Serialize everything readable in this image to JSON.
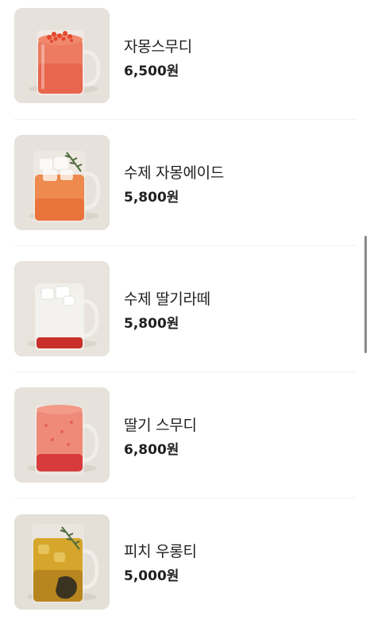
{
  "menu": {
    "items": [
      {
        "name": "자몽스무디",
        "price": "6,500원"
      },
      {
        "name": "수제 자몽에이드",
        "price": "5,800원"
      },
      {
        "name": "수제 딸기라떼",
        "price": "5,800원"
      },
      {
        "name": "딸기 스무디",
        "price": "6,800원"
      },
      {
        "name": "피치 우롱티",
        "price": "5,000원"
      }
    ]
  },
  "images": [
    {
      "icon": "grapefruit-smoothie-image"
    },
    {
      "icon": "grapefruit-ade-image"
    },
    {
      "icon": "strawberry-latte-image"
    },
    {
      "icon": "strawberry-smoothie-image"
    },
    {
      "icon": "peach-oolong-tea-image"
    }
  ],
  "colors": {
    "thumb_background": "#e7e3dd",
    "divider": "#f0f0f0",
    "scrollbar": "#8a8a8a",
    "text": "#1f1f1f"
  }
}
